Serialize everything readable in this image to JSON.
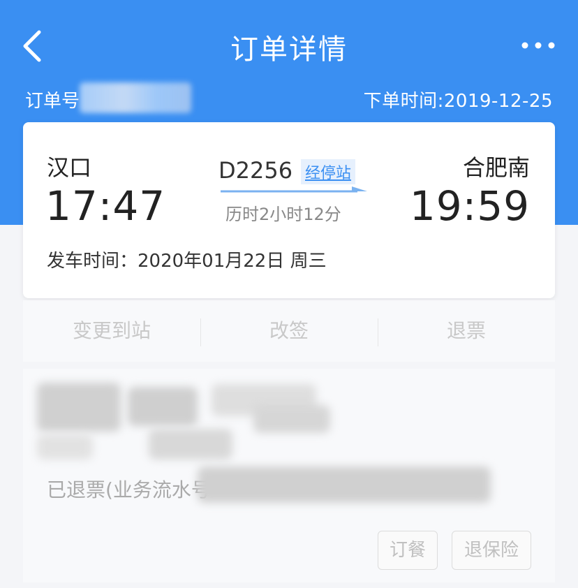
{
  "nav": {
    "title": "订单详情",
    "back_icon": "chevron-left-icon",
    "more_icon": "more-horizontal-icon"
  },
  "order": {
    "number_label": "订单号",
    "time": "下单时间:2019-12-25"
  },
  "trip": {
    "from_station": "汉口",
    "from_time": "17:47",
    "to_station": "合肥南",
    "to_time": "19:59",
    "train_no": "D2256",
    "stops_link": "经停站",
    "duration": "历时2小时12分",
    "depart_date": "发车时间：2020年01月22日 周三"
  },
  "actions": {
    "change_station": "变更到站",
    "reschedule": "改签",
    "refund": "退票"
  },
  "detail": {
    "refund_status": "已退票(业务流水号",
    "meal_button": "订餐",
    "insurance_refund_button": "退保险"
  },
  "colors": {
    "primary": "#3a8ff2",
    "text_dark": "#222222",
    "text_muted": "#888888",
    "disabled": "#c8c8c8"
  }
}
